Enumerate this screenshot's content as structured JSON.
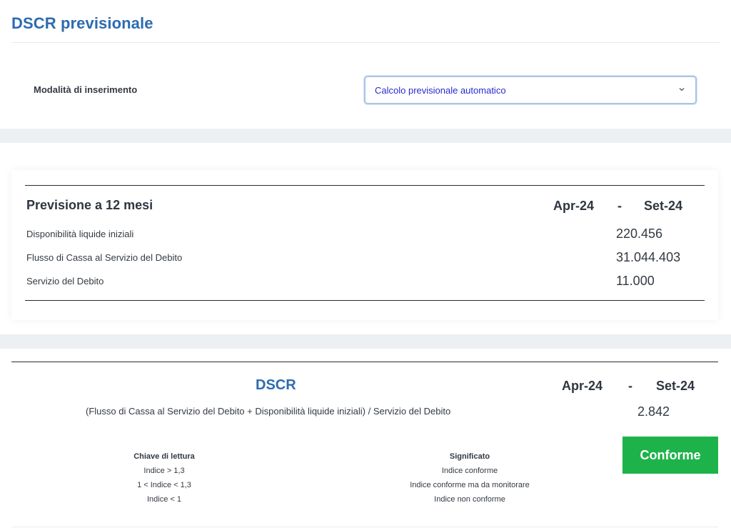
{
  "header": {
    "title": "DSCR previsionale",
    "mode_label": "Modalità di inserimento",
    "mode_select": {
      "value": "Calcolo previsionale automatico"
    }
  },
  "forecast": {
    "title": "Previsione a 12 mesi",
    "period_start": "Apr-24",
    "period_sep": "-",
    "period_end": "Set-24",
    "rows": [
      {
        "label": "Disponibilità liquide iniziali",
        "value": "220.456"
      },
      {
        "label": "Flusso di Cassa al Servizio del Debito",
        "value": "31.044.403"
      },
      {
        "label": "Servizio del Debito",
        "value": "11.000"
      }
    ]
  },
  "dscr": {
    "title": "DSCR",
    "period_start": "Apr-24",
    "period_sep": "-",
    "period_end": "Set-24",
    "formula": "(Flusso di Cassa al Servizio del Debito + Disponibilità liquide iniziali) / Servizio del Debito",
    "value": "2.842",
    "status_label": "Conforme",
    "status_color": "#1db34a",
    "key_header": "Chiave di lettura",
    "meaning_header": "Significato",
    "legend": [
      {
        "key": "Indice > 1,3",
        "meaning": "Indice conforme"
      },
      {
        "key": "1 < Indice < 1,3",
        "meaning": "Indice conforme ma da monitorare"
      },
      {
        "key": "Indice < 1",
        "meaning": "Indice non conforme"
      }
    ]
  },
  "colors": {
    "accent": "#2d6bb0",
    "band": "#edf0f3"
  }
}
